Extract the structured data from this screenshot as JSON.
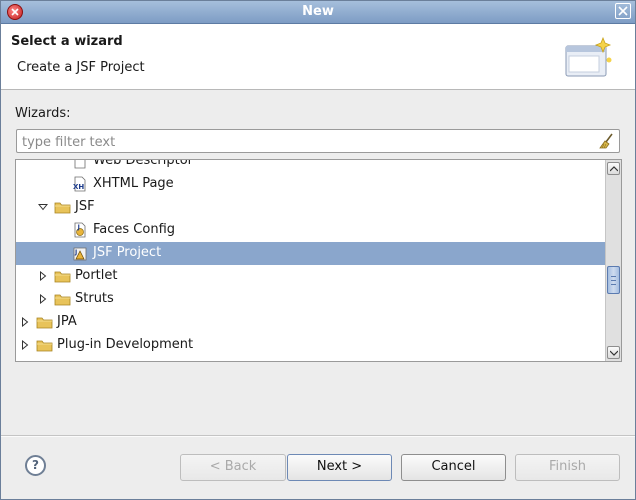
{
  "window": {
    "title": "New"
  },
  "header": {
    "title": "Select a wizard",
    "description": "Create a JSF Project"
  },
  "wizards_label": "Wizards:",
  "filter": {
    "placeholder": "type filter text",
    "value": ""
  },
  "tree": {
    "items": [
      {
        "label": "Web Descriptor",
        "level": 2,
        "expanded": null,
        "icon": "file-icon",
        "selected": false
      },
      {
        "label": "XHTML Page",
        "level": 2,
        "expanded": null,
        "icon": "xhtml-page-icon",
        "selected": false
      },
      {
        "label": "JSF",
        "level": 1,
        "expanded": true,
        "icon": "folder-icon",
        "selected": false
      },
      {
        "label": "Faces Config",
        "level": 2,
        "expanded": null,
        "icon": "faces-config-icon",
        "selected": false
      },
      {
        "label": "JSF Project",
        "level": 2,
        "expanded": null,
        "icon": "jsf-project-icon",
        "selected": true
      },
      {
        "label": "Portlet",
        "level": 1,
        "expanded": false,
        "icon": "folder-icon",
        "selected": false
      },
      {
        "label": "Struts",
        "level": 1,
        "expanded": false,
        "icon": "folder-icon",
        "selected": false
      },
      {
        "label": "JPA",
        "level": 0,
        "expanded": false,
        "icon": "folder-icon",
        "selected": false
      },
      {
        "label": "Plug-in Development",
        "level": 0,
        "expanded": false,
        "icon": "folder-icon",
        "selected": false
      }
    ]
  },
  "buttons": {
    "back": "< Back",
    "next": "Next >",
    "cancel": "Cancel",
    "finish": "Finish"
  },
  "colors": {
    "selection": "#8aa6cc",
    "titlebar": "#8ea9cf",
    "folder": "#e8c35a"
  }
}
